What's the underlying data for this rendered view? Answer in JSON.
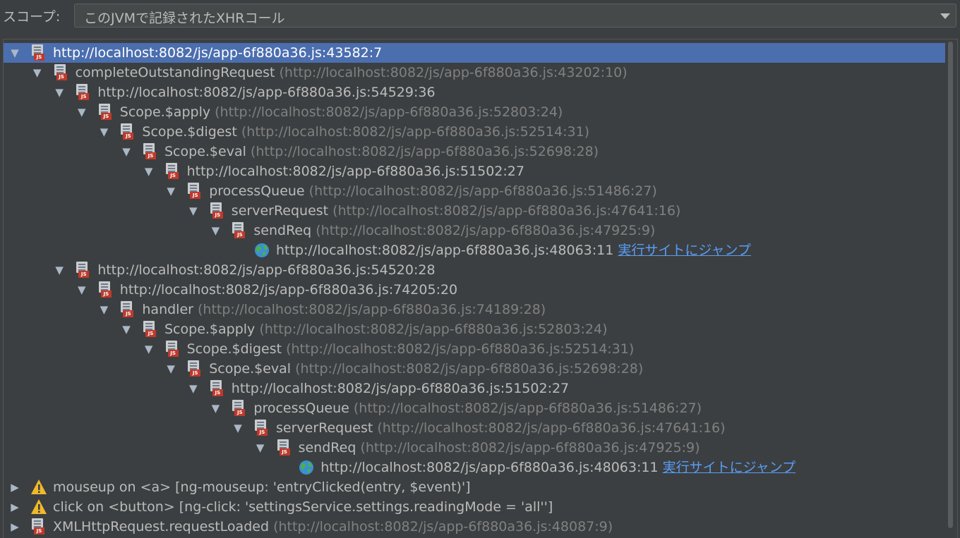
{
  "scope": {
    "label": "スコープ:",
    "value": "このJVMで記録されたXHRコール"
  },
  "tree": {
    "rows": [
      {
        "depth": 0,
        "toggle": "▼",
        "icon": "js-file-icon",
        "text": "http://localhost:8082/js/app-6f880a36.js:43582:7",
        "location": "",
        "link": "",
        "selected": true
      },
      {
        "depth": 1,
        "toggle": "▼",
        "icon": "js-file-icon",
        "text": "completeOutstandingRequest",
        "location": "(http://localhost:8082/js/app-6f880a36.js:43202:10)",
        "link": ""
      },
      {
        "depth": 2,
        "toggle": "▼",
        "icon": "js-file-icon",
        "text": "http://localhost:8082/js/app-6f880a36.js:54529:36",
        "location": "",
        "link": ""
      },
      {
        "depth": 3,
        "toggle": "▼",
        "icon": "js-file-icon",
        "text": "Scope.$apply",
        "location": "(http://localhost:8082/js/app-6f880a36.js:52803:24)",
        "link": ""
      },
      {
        "depth": 4,
        "toggle": "▼",
        "icon": "js-file-icon",
        "text": "Scope.$digest",
        "location": "(http://localhost:8082/js/app-6f880a36.js:52514:31)",
        "link": ""
      },
      {
        "depth": 5,
        "toggle": "▼",
        "icon": "js-file-icon",
        "text": "Scope.$eval",
        "location": "(http://localhost:8082/js/app-6f880a36.js:52698:28)",
        "link": ""
      },
      {
        "depth": 6,
        "toggle": "▼",
        "icon": "js-file-icon",
        "text": "http://localhost:8082/js/app-6f880a36.js:51502:27",
        "location": "",
        "link": ""
      },
      {
        "depth": 7,
        "toggle": "▼",
        "icon": "js-file-icon",
        "text": "processQueue",
        "location": "(http://localhost:8082/js/app-6f880a36.js:51486:27)",
        "link": ""
      },
      {
        "depth": 8,
        "toggle": "▼",
        "icon": "js-file-icon",
        "text": "serverRequest",
        "location": "(http://localhost:8082/js/app-6f880a36.js:47641:16)",
        "link": ""
      },
      {
        "depth": 9,
        "toggle": "▼",
        "icon": "js-file-icon",
        "text": "sendReq",
        "location": "(http://localhost:8082/js/app-6f880a36.js:47925:9)",
        "link": ""
      },
      {
        "depth": 10,
        "toggle": "",
        "icon": "globe-icon",
        "text": "http://localhost:8082/js/app-6f880a36.js:48063:11",
        "location": "",
        "link": "実行サイトにジャンプ"
      },
      {
        "depth": 2,
        "toggle": "▼",
        "icon": "js-file-icon",
        "text": "http://localhost:8082/js/app-6f880a36.js:54520:28",
        "location": "",
        "link": ""
      },
      {
        "depth": 3,
        "toggle": "▼",
        "icon": "js-file-icon",
        "text": "http://localhost:8082/js/app-6f880a36.js:74205:20",
        "location": "",
        "link": ""
      },
      {
        "depth": 4,
        "toggle": "▼",
        "icon": "js-file-icon",
        "text": "handler",
        "location": "(http://localhost:8082/js/app-6f880a36.js:74189:28)",
        "link": ""
      },
      {
        "depth": 5,
        "toggle": "▼",
        "icon": "js-file-icon",
        "text": "Scope.$apply",
        "location": "(http://localhost:8082/js/app-6f880a36.js:52803:24)",
        "link": ""
      },
      {
        "depth": 6,
        "toggle": "▼",
        "icon": "js-file-icon",
        "text": "Scope.$digest",
        "location": "(http://localhost:8082/js/app-6f880a36.js:52514:31)",
        "link": ""
      },
      {
        "depth": 7,
        "toggle": "▼",
        "icon": "js-file-icon",
        "text": "Scope.$eval",
        "location": "(http://localhost:8082/js/app-6f880a36.js:52698:28)",
        "link": ""
      },
      {
        "depth": 8,
        "toggle": "▼",
        "icon": "js-file-icon",
        "text": "http://localhost:8082/js/app-6f880a36.js:51502:27",
        "location": "",
        "link": ""
      },
      {
        "depth": 9,
        "toggle": "▼",
        "icon": "js-file-icon",
        "text": "processQueue",
        "location": "(http://localhost:8082/js/app-6f880a36.js:51486:27)",
        "link": ""
      },
      {
        "depth": 10,
        "toggle": "▼",
        "icon": "js-file-icon",
        "text": "serverRequest",
        "location": "(http://localhost:8082/js/app-6f880a36.js:47641:16)",
        "link": ""
      },
      {
        "depth": 11,
        "toggle": "▼",
        "icon": "js-file-icon",
        "text": "sendReq",
        "location": "(http://localhost:8082/js/app-6f880a36.js:47925:9)",
        "link": ""
      },
      {
        "depth": 12,
        "toggle": "",
        "icon": "globe-icon",
        "text": "http://localhost:8082/js/app-6f880a36.js:48063:11",
        "location": "",
        "link": "実行サイトにジャンプ"
      },
      {
        "depth": 0,
        "toggle": "▶",
        "icon": "warning-icon",
        "text": "mouseup on <a> [ng-mouseup: 'entryClicked(entry, $event)']",
        "location": "",
        "link": ""
      },
      {
        "depth": 0,
        "toggle": "▶",
        "icon": "warning-icon",
        "text": "click on <button> [ng-click: 'settingsService.settings.readingMode = 'all'']",
        "location": "",
        "link": ""
      },
      {
        "depth": 0,
        "toggle": "▶",
        "icon": "js-file-icon",
        "text": "XMLHttpRequest.requestLoaded",
        "location": "(http://localhost:8082/js/app-6f880a36.js:48087:9)",
        "link": ""
      }
    ]
  },
  "colors": {
    "background": "#3c3f41",
    "selection": "#4b6eaf",
    "link": "#589df6",
    "secondary_text": "#808080"
  }
}
